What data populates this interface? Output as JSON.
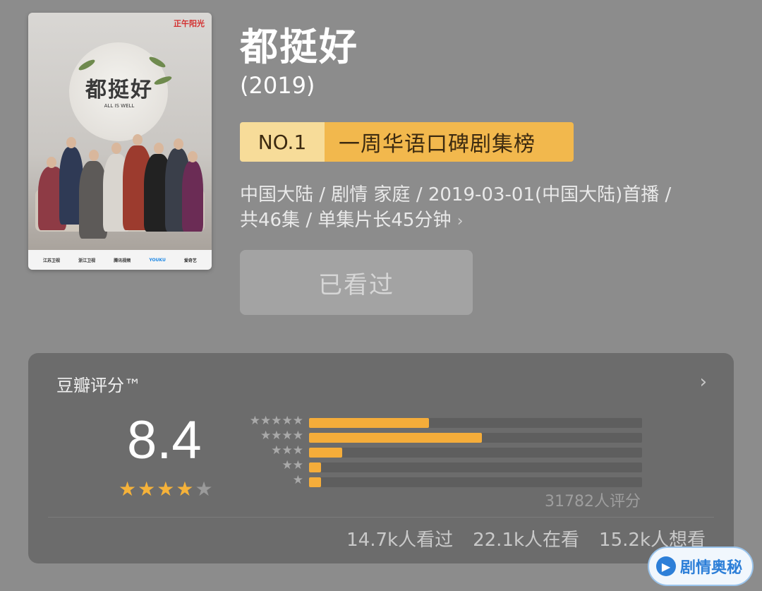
{
  "show": {
    "title": "都挺好",
    "year": "(2019)",
    "rank_no": "NO.1",
    "rank_label": "一周华语口碑剧集榜",
    "meta_line1": "中国大陆 / 剧情 家庭 / 2019-03-01(中国大陆)首播 /",
    "meta_line2": "共46集 / 单集片长45分钟",
    "watched_button": "已看过"
  },
  "poster": {
    "logo_text": "都挺好",
    "logo_sub": "ALL IS WELL",
    "brand_top": "正午阳光",
    "bottom_logos": [
      "江苏卫视",
      "浙江卫视",
      "腾讯视频",
      "YOUKU",
      "爱奇艺"
    ]
  },
  "rating": {
    "card_title": "豆瓣评分™",
    "score": "8.4",
    "stars_filled": 4,
    "stars_total": 5,
    "distribution": [
      {
        "stars": "★★★★★",
        "fraction": 0.36
      },
      {
        "stars": "★★★★",
        "fraction": 0.52
      },
      {
        "stars": "★★★",
        "fraction": 0.1
      },
      {
        "stars": "★★",
        "fraction": 0.035
      },
      {
        "stars": "★",
        "fraction": 0.035
      }
    ],
    "vote_count": "31782人评分",
    "watched": "14.7k人看过",
    "watching": "22.1k人在看",
    "want": "15.2k人想看"
  },
  "watermark": {
    "text": "剧情奥秘"
  },
  "colors": {
    "background": "#8c8c8c",
    "card": "#6c6c6c",
    "accent": "#f5ad3a"
  }
}
